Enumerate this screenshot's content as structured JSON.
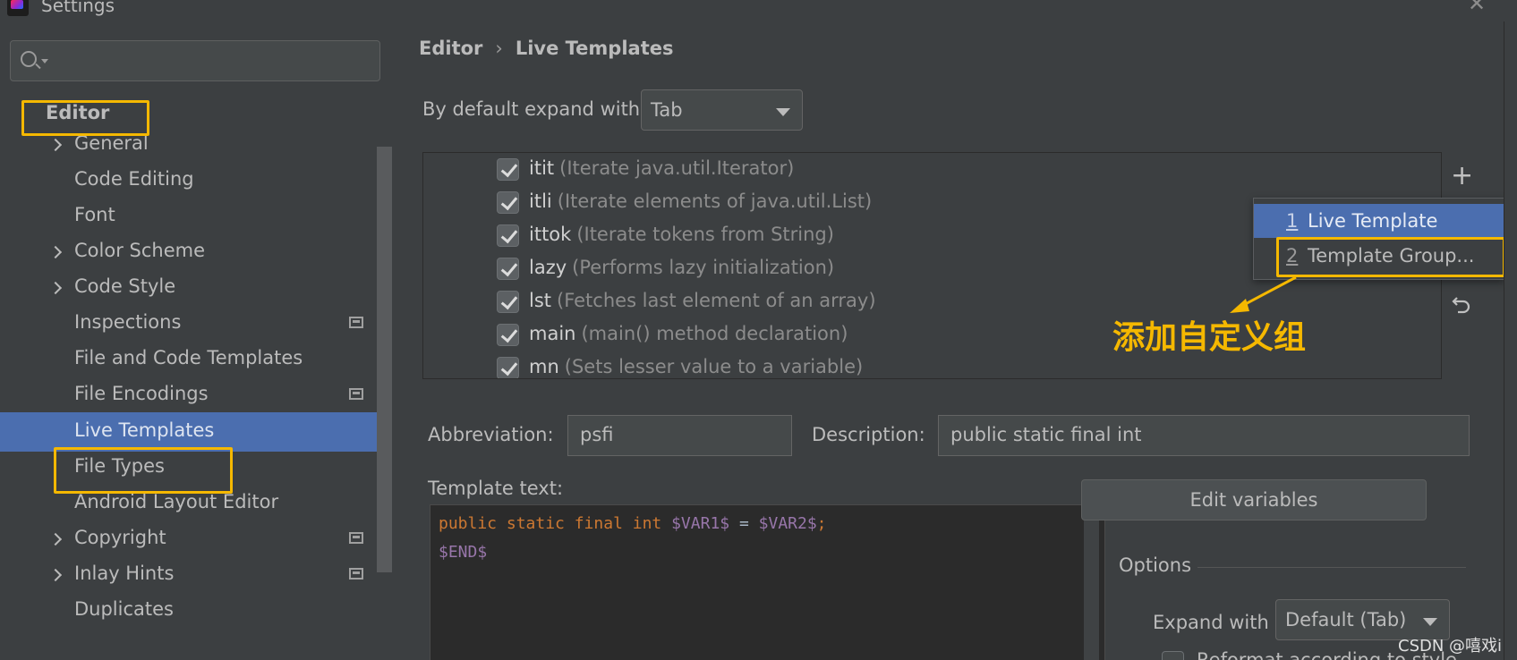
{
  "window": {
    "title": "Settings"
  },
  "sidebar": {
    "search": {
      "placeholder": ""
    },
    "items": [
      {
        "label": "Editor",
        "type": "root"
      },
      {
        "label": "General",
        "expandable": true
      },
      {
        "label": "Code Editing"
      },
      {
        "label": "Font"
      },
      {
        "label": "Color Scheme",
        "expandable": true
      },
      {
        "label": "Code Style",
        "expandable": true
      },
      {
        "label": "Inspections",
        "project_icon": true
      },
      {
        "label": "File and Code Templates"
      },
      {
        "label": "File Encodings",
        "project_icon": true
      },
      {
        "label": "Live Templates",
        "selected": true
      },
      {
        "label": "File Types"
      },
      {
        "label": "Android Layout Editor"
      },
      {
        "label": "Copyright",
        "expandable": true,
        "project_icon": true
      },
      {
        "label": "Inlay Hints",
        "expandable": true,
        "project_icon": true
      },
      {
        "label": "Duplicates"
      }
    ]
  },
  "main": {
    "breadcrumb": {
      "parent": "Editor",
      "separator": "›",
      "current": "Live Templates"
    },
    "expand": {
      "label": "By default expand with",
      "value": "Tab"
    },
    "templates": [
      {
        "abbr": "itit",
        "desc": "(Iterate java.util.Iterator)",
        "checked": true
      },
      {
        "abbr": "itli",
        "desc": "(Iterate elements of java.util.List)",
        "checked": true
      },
      {
        "abbr": "ittok",
        "desc": "(Iterate tokens from String)",
        "checked": true
      },
      {
        "abbr": "lazy",
        "desc": "(Performs lazy initialization)",
        "checked": true
      },
      {
        "abbr": "lst",
        "desc": "(Fetches last element of an array)",
        "checked": true
      },
      {
        "abbr": "main",
        "desc": "(main() method declaration)",
        "checked": true
      },
      {
        "abbr": "mn",
        "desc": "(Sets lesser value to a variable)",
        "checked": true
      }
    ],
    "toolbar": {
      "add_icon": "plus-icon",
      "revert_icon": "undo-icon"
    },
    "add_menu": {
      "items": [
        {
          "num": "1",
          "label": "Live Template",
          "active": true
        },
        {
          "num": "2",
          "label": "Template Group..."
        }
      ]
    },
    "annotation": "添加自定义组",
    "abbreviation": {
      "label": "Abbreviation:",
      "value": "psfi"
    },
    "description": {
      "label": "Description:",
      "value": "public static final int"
    },
    "template_text": {
      "label": "Template text:",
      "line1": {
        "keywords": "public static final int",
        "var1": "$VAR1$",
        "eq": " = ",
        "var2": "$VAR2$",
        "semi": ";"
      },
      "line2": "$END$"
    },
    "edit_variables": "Edit variables",
    "options": {
      "label": "Options",
      "expand_with_label": "Expand with",
      "expand_with_value": "Default (Tab)",
      "reformat_label": "Reformat according to style"
    }
  },
  "watermark": "CSDN @嘻戏i",
  "colors": {
    "accent": "#4b6eaf",
    "highlight": "#f5b800",
    "keyword": "#cc7832",
    "variable": "#9876aa",
    "background": "#3c3f41"
  }
}
